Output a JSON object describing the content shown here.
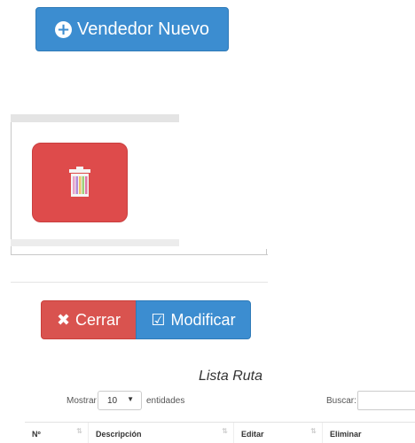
{
  "header": {
    "new_vendor_label": "Vendedor Nuevo"
  },
  "icons": {
    "new_vendor": "plus-circle-icon",
    "delete": "trash-icon",
    "close": "times-icon",
    "modify": "check-square-icon",
    "sort": "sort-arrows-icon"
  },
  "actions": {
    "close_label": "Cerrar",
    "modify_label": "Modificar"
  },
  "list": {
    "title": "Lista Ruta",
    "show_label": "Mostrar",
    "page_length": "10",
    "entries_label": "entidades",
    "search_label": "Buscar:",
    "search_value": "",
    "columns": [
      "Nº",
      "Descripción",
      "Editar",
      "Eliminar"
    ]
  },
  "colors": {
    "primary": "#3c8dd0",
    "danger": "#d9534f",
    "trash_bg": "#de4b4b"
  }
}
